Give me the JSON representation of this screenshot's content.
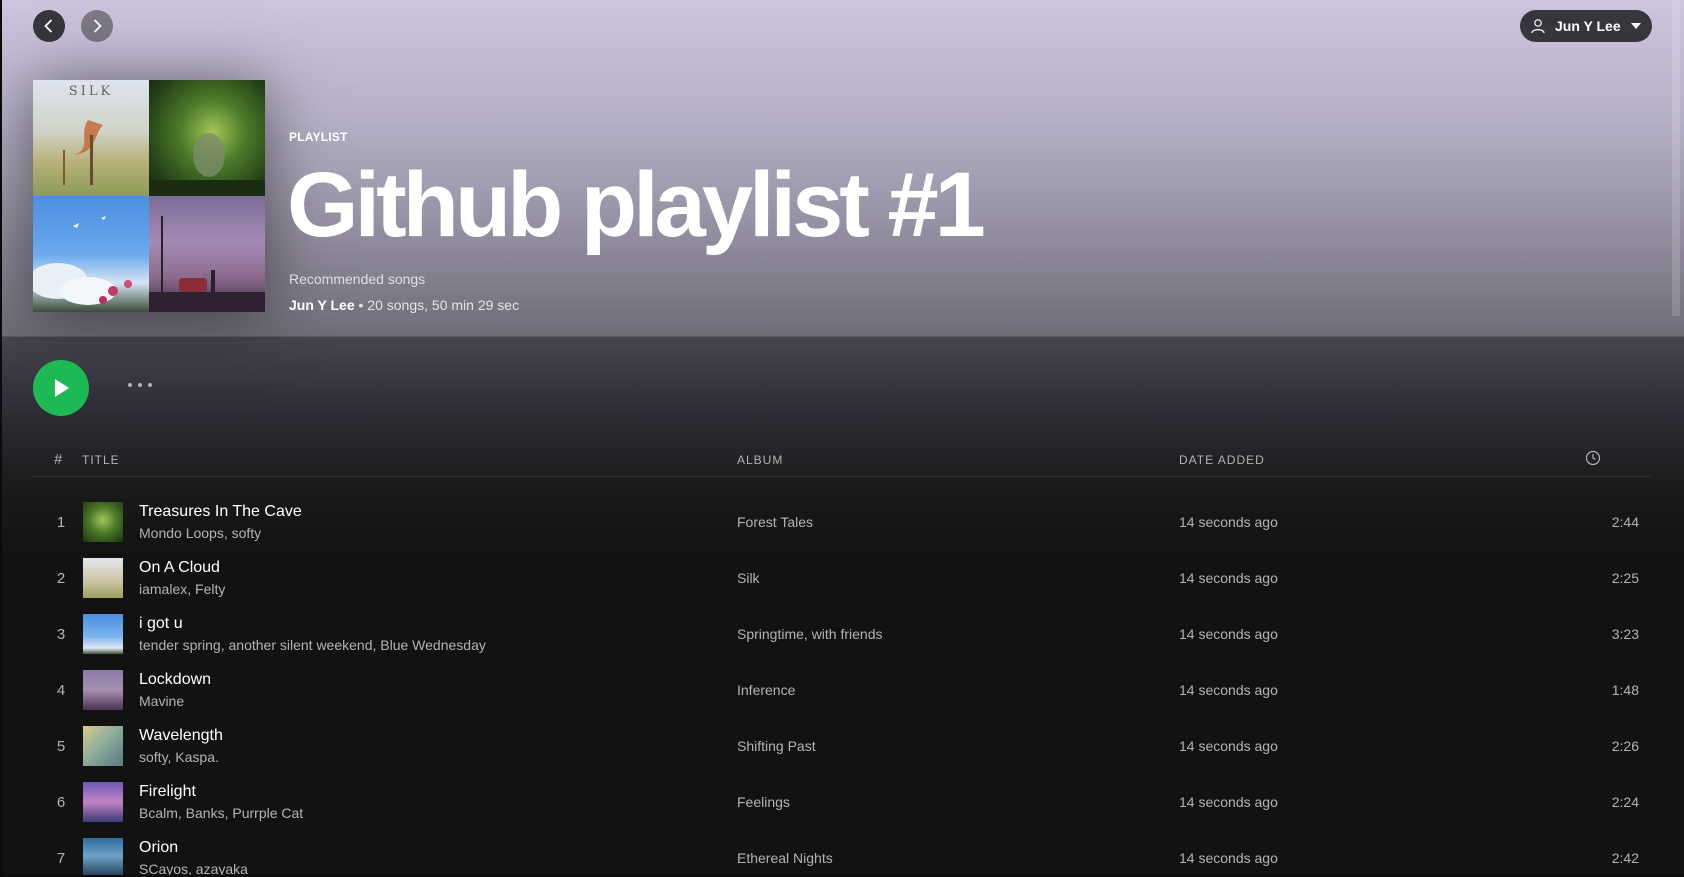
{
  "header": {
    "user_name": "Jun Y Lee"
  },
  "playlist": {
    "type_label": "PLAYLIST",
    "title": "Github playlist #1",
    "description": "Recommended songs",
    "owner": "Jun Y Lee",
    "meta": " • 20 songs, 50 min 29 sec",
    "cover_text": "SILK"
  },
  "table": {
    "headers": {
      "num": "#",
      "title": "TITLE",
      "album": "ALBUM",
      "date_added": "DATE ADDED"
    },
    "rows": [
      {
        "num": "1",
        "title": "Treasures In The Cave",
        "artists": "Mondo Loops, softy",
        "album": "Forest Tales",
        "date_added": "14 seconds ago",
        "duration": "2:44"
      },
      {
        "num": "2",
        "title": "On A Cloud",
        "artists": "iamalex, Felty",
        "album": "Silk",
        "date_added": "14 seconds ago",
        "duration": "2:25"
      },
      {
        "num": "3",
        "title": "i got u",
        "artists": "tender spring, another silent weekend, Blue Wednesday",
        "album": "Springtime, with friends",
        "date_added": "14 seconds ago",
        "duration": "3:23"
      },
      {
        "num": "4",
        "title": "Lockdown",
        "artists": "Mavine",
        "album": "Inference",
        "date_added": "14 seconds ago",
        "duration": "1:48"
      },
      {
        "num": "5",
        "title": "Wavelength",
        "artists": "softy, Kaspa.",
        "album": "Shifting Past",
        "date_added": "14 seconds ago",
        "duration": "2:26"
      },
      {
        "num": "6",
        "title": "Firelight",
        "artists": "Bcalm, Banks, Purrple Cat",
        "album": "Feelings",
        "date_added": "14 seconds ago",
        "duration": "2:24"
      },
      {
        "num": "7",
        "title": "Orion",
        "artists": "SCayos, azayaka",
        "album": "Ethereal Nights",
        "date_added": "14 seconds ago",
        "duration": "2:42"
      }
    ]
  },
  "icons": {
    "back": "chevron-left-icon",
    "forward": "chevron-right-icon",
    "user": "user-icon",
    "dropdown": "caret-down-icon",
    "play": "play-icon",
    "more": "more-dots-icon",
    "duration": "clock-icon"
  },
  "colors": {
    "accent_green": "#1db954",
    "background": "#121212",
    "header_gradient_top": "#cdc5de",
    "muted_text": "#b3b3b3"
  }
}
